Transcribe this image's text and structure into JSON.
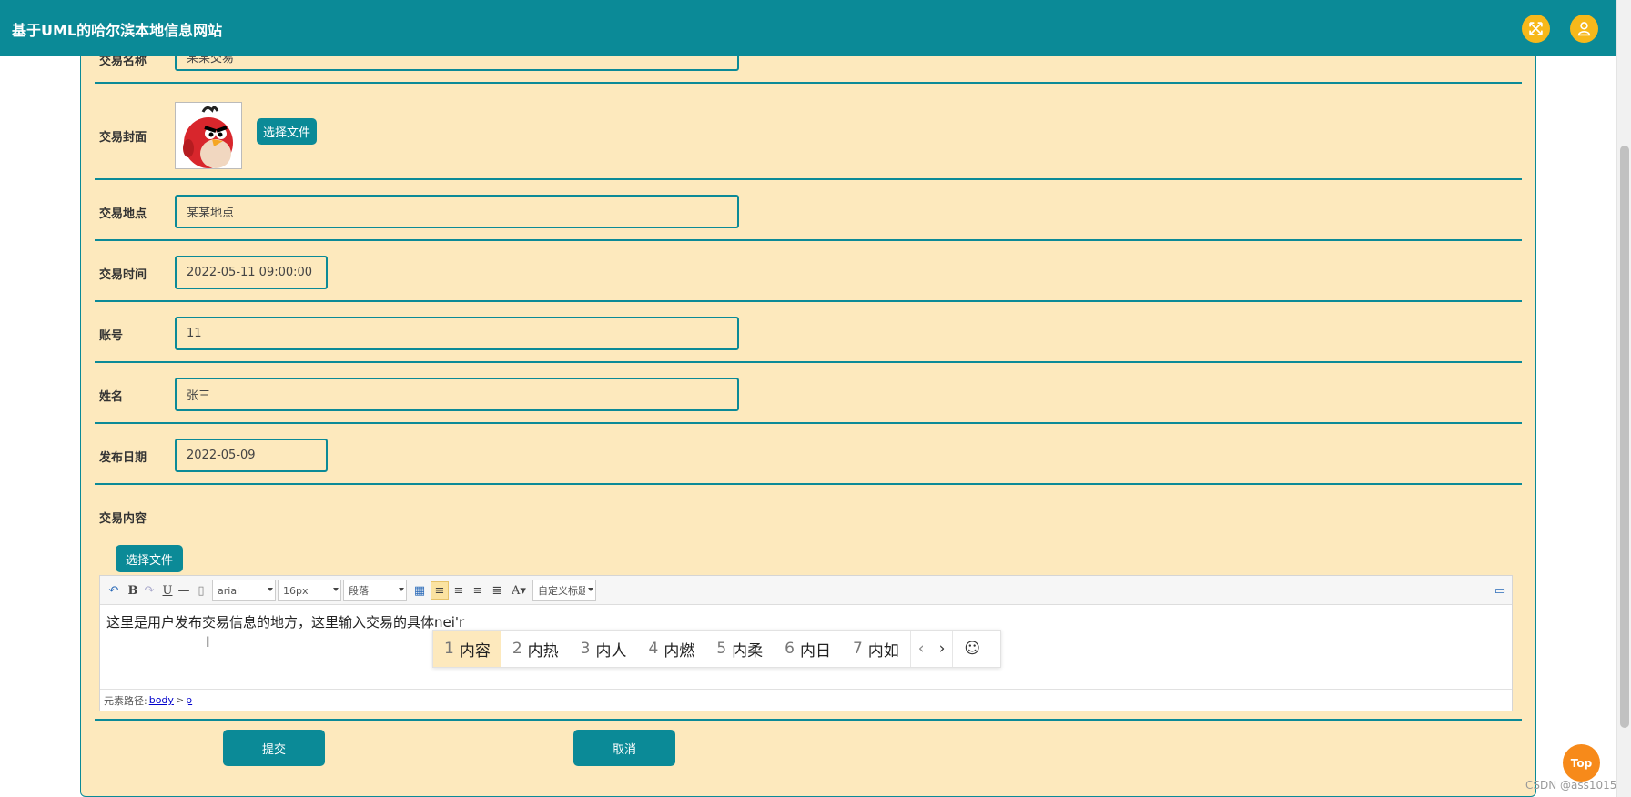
{
  "header": {
    "title": "基于UML的哈尔滨本地信息网站"
  },
  "form": {
    "name_label": "交易名称",
    "name_value": "某某交易",
    "cover_label": "交易封面",
    "cover_button": "选择文件",
    "place_label": "交易地点",
    "place_value": "某某地点",
    "time_label": "交易时间",
    "time_value": "2022-05-11 09:00:00",
    "account_label": "账号",
    "account_value": "11",
    "username_label": "姓名",
    "username_value": "张三",
    "publish_label": "发布日期",
    "publish_value": "2022-05-09",
    "content_label": "交易内容",
    "content_file_button": "选择文件"
  },
  "editor": {
    "toolbar": {
      "font_family": "arial",
      "font_size": "16px",
      "paragraph": "段落",
      "custom_title": "自定义标题"
    },
    "content_text": "这里是用户发布交易信息的地方，这里输入交易的具体nei'r",
    "path_label": "元素路径:",
    "path_body": "body",
    "path_sep": ">",
    "path_p": "p"
  },
  "ime": {
    "candidates": [
      {
        "num": "1",
        "text": "内容"
      },
      {
        "num": "2",
        "text": "内热"
      },
      {
        "num": "3",
        "text": "内人"
      },
      {
        "num": "4",
        "text": "内燃"
      },
      {
        "num": "5",
        "text": "内柔"
      },
      {
        "num": "6",
        "text": "内日"
      },
      {
        "num": "7",
        "text": "内如"
      }
    ],
    "prev": "‹",
    "next": "›",
    "emoji": "☺"
  },
  "actions": {
    "submit": "提交",
    "cancel": "取消"
  },
  "top_button": "Top",
  "watermark": "CSDN @ass1015",
  "colors": {
    "primary": "#0b8a97",
    "panel_bg": "#fde9bd",
    "accent": "#f7b81a",
    "top": "#f78a1a"
  }
}
